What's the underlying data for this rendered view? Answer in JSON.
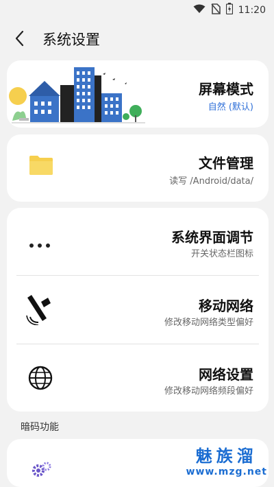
{
  "status_bar": {
    "time": "11:20",
    "icons": [
      "wifi-icon",
      "no-sim-icon",
      "battery-charging-icon"
    ]
  },
  "header": {
    "title": "系统设置",
    "back_icon": "back-arrow-icon"
  },
  "items": [
    {
      "title": "屏幕模式",
      "subtitle": "自然 (默认)",
      "icon": "city-illustration"
    },
    {
      "title": "文件管理",
      "subtitle": "读写 /Android/data/",
      "icon": "folder-icon"
    },
    {
      "title": "系统界面调节",
      "subtitle": "开关状态栏图标",
      "icon": "more-dots-icon"
    },
    {
      "title": "移动网络",
      "subtitle": "修改移动网络类型偏好",
      "icon": "satellite-icon"
    },
    {
      "title": "网络设置",
      "subtitle": "修改移动网络频段偏好",
      "icon": "globe-icon"
    }
  ],
  "section": {
    "label": "暗码功能"
  },
  "watermark": {
    "line1": "魅族溜",
    "line2": "www.mzg.net"
  },
  "colors": {
    "background": "#f2f2f2",
    "card": "#ffffff",
    "subtitle_accent": "#2e6fd8",
    "folder": "#f6cf4e",
    "watermark": "#1b6dd2"
  }
}
